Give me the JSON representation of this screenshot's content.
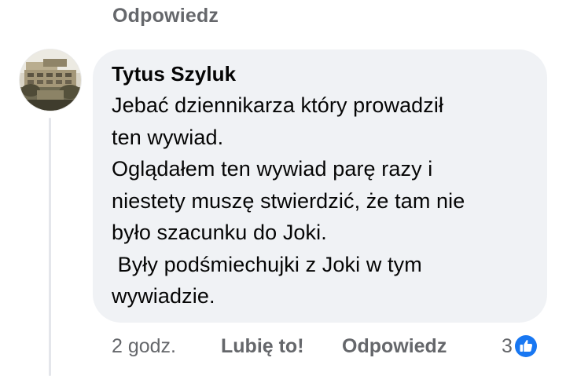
{
  "previous": {
    "reply_label": "Odpowiedz"
  },
  "comment": {
    "author": "Tytus Szyluk",
    "lines": [
      "Jebać dziennikarza który prowadził",
      "ten wywiad.",
      "Oglądałem ten wywiad parę razy i",
      "niestety muszę stwierdzić, że tam nie",
      "było szacunku do Joki.",
      " Były podśmiechujki z Joki w tym",
      "wywiadzie."
    ],
    "time": "2 godz.",
    "like_label": "Lubię to!",
    "reply_label": "Odpowiedz",
    "reaction_count": "3",
    "reaction_icon": "like-icon"
  },
  "colors": {
    "bubble": "#f0f2f5",
    "secondary_text": "#65676b",
    "like_blue": "#1877f2"
  }
}
